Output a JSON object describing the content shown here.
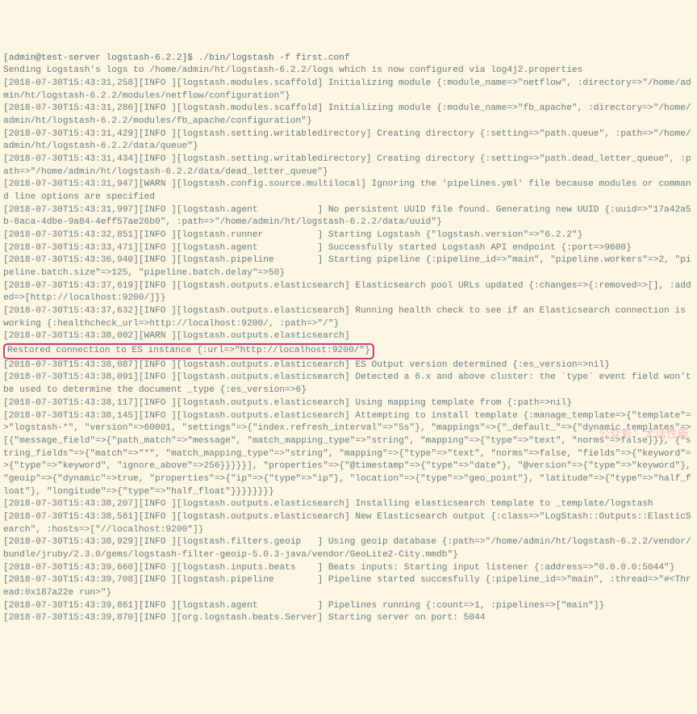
{
  "prompt": "[admin@test-server logstash-6.2.2]$ ",
  "command": "./bin/logstash -f first.conf",
  "lines": [
    "Sending Logstash's logs to /home/admin/ht/logstash-6.2.2/logs which is now configured via log4j2.properties",
    "[2018-07-30T15:43:31,258][INFO ][logstash.modules.scaffold] Initializing module {:module_name=>\"netflow\", :directory=>\"/home/admin/ht/logstash-6.2.2/modules/netflow/configuration\"}",
    "[2018-07-30T15:43:31,286][INFO ][logstash.modules.scaffold] Initializing module {:module_name=>\"fb_apache\", :directory=>\"/home/admin/ht/logstash-6.2.2/modules/fb_apache/configuration\"}",
    "[2018-07-30T15:43:31,429][INFO ][logstash.setting.writabledirectory] Creating directory {:setting=>\"path.queue\", :path=>\"/home/admin/ht/logstash-6.2.2/data/queue\"}",
    "[2018-07-30T15:43:31,434][INFO ][logstash.setting.writabledirectory] Creating directory {:setting=>\"path.dead_letter_queue\", :path=>\"/home/admin/ht/logstash-6.2.2/data/dead_letter_queue\"}",
    "[2018-07-30T15:43:31,947][WARN ][logstash.config.source.multilocal] Ignoring the 'pipelines.yml' file because modules or command line options are specified",
    "[2018-07-30T15:43:31,997][INFO ][logstash.agent           ] No persistent UUID file found. Generating new UUID {:uuid=>\"17a42a5b-8aca-4dbe-9a84-4eff57ae26b0\", :path=>\"/home/admin/ht/logstash-6.2.2/data/uuid\"}",
    "[2018-07-30T15:43:32,851][INFO ][logstash.runner          ] Starting Logstash {\"logstash.version\"=>\"6.2.2\"}",
    "[2018-07-30T15:43:33,471][INFO ][logstash.agent           ] Successfully started Logstash API endpoint {:port=>9600}",
    "[2018-07-30T15:43:36,940][INFO ][logstash.pipeline        ] Starting pipeline {:pipeline_id=>\"main\", \"pipeline.workers\"=>2, \"pipeline.batch.size\"=>125, \"pipeline.batch.delay\"=>50}",
    "[2018-07-30T15:43:37,619][INFO ][logstash.outputs.elasticsearch] Elasticsearch pool URLs updated {:changes=>{:removed=>[], :added=>[http://localhost:9200/]}}",
    "[2018-07-30T15:43:37,632][INFO ][logstash.outputs.elasticsearch] Running health check to see if an Elasticsearch connection is working {:healthcheck_url=>http://localhost:9200/, :path=>\"/\"}"
  ],
  "highlight_prefix": "[2018-07-30T15:43:38,002][WARN ][logstash.outputs.elasticsearch] ",
  "highlight_text": "Restored connection to ES instance {:url=>\"http://localhost:9200/\"}",
  "covered_line": "[2018-07-30T15:43:38,087][INFO ][logstash.outputs.elasticsearch] ES Output version determined {:es_version=>nil}",
  "lines_after": [
    "[2018-07-30T15:43:38,091][INFO ][logstash.outputs.elasticsearch] Detected a 6.x and above cluster: the `type` event field won't be used to determine the document _type {:es_version=>6}",
    "[2018-07-30T15:43:38,117][INFO ][logstash.outputs.elasticsearch] Using mapping template from {:path=>nil}",
    "[2018-07-30T15:43:38,145][INFO ][logstash.outputs.elasticsearch] Attempting to install template {:manage_template=>{\"template\"=>\"logstash-*\", \"version\"=>60001, \"settings\"=>{\"index.refresh_interval\"=>\"5s\"}, \"mappings\"=>{\"_default_\"=>{\"dynamic_templates\"=>[{\"message_field\"=>{\"path_match\"=>\"message\", \"match_mapping_type\"=>\"string\", \"mapping\"=>{\"type\"=>\"text\", \"norms\"=>false}}}, {\"string_fields\"=>{\"match\"=>\"*\", \"match_mapping_type\"=>\"string\", \"mapping\"=>{\"type\"=>\"text\", \"norms\"=>false, \"fields\"=>{\"keyword\"=>{\"type\"=>\"keyword\", \"ignore_above\"=>256}}}}}], \"properties\"=>{\"@timestamp\"=>{\"type\"=>\"date\"}, \"@version\"=>{\"type\"=>\"keyword\"}, \"geoip\"=>{\"dynamic\"=>true, \"properties\"=>{\"ip\"=>{\"type\"=>\"ip\"}, \"location\"=>{\"type\"=>\"geo_point\"}, \"latitude\"=>{\"type\"=>\"half_float\"}, \"longitude\"=>{\"type\"=>\"half_float\"}}}}}}}}",
    "[2018-07-30T15:43:38,207][INFO ][logstash.outputs.elasticsearch] Installing elasticsearch template to _template/logstash",
    "[2018-07-30T15:43:38,561][INFO ][logstash.outputs.elasticsearch] New Elasticsearch output {:class=>\"LogStash::Outputs::ElasticSearch\", :hosts=>[\"//localhost:9200\"]}",
    "[2018-07-30T15:43:38,929][INFO ][logstash.filters.geoip   ] Using geoip database {:path=>\"/home/admin/ht/logstash-6.2.2/vendor/bundle/jruby/2.3.0/gems/logstash-filter-geoip-5.0.3-java/vendor/GeoLite2-City.mmdb\"}",
    "[2018-07-30T15:43:39,660][INFO ][logstash.inputs.beats    ] Beats inputs: Starting input listener {:address=>\"0.0.0.0:5044\"}",
    "[2018-07-30T15:43:39,708][INFO ][logstash.pipeline        ] Pipeline started succesfully {:pipeline_id=>\"main\", :thread=>\"#<Thread:0x187a22e run>\"}",
    "[2018-07-30T15:43:39,861][INFO ][logstash.agent           ] Pipelines running {:count=>1, :pipelines=>[\"main\"]}",
    "[2018-07-30T15:43:39,870][INFO ][org.logstash.beats.Server] Starting server on port: 5044"
  ],
  "watermark": "公众号：大话性能"
}
